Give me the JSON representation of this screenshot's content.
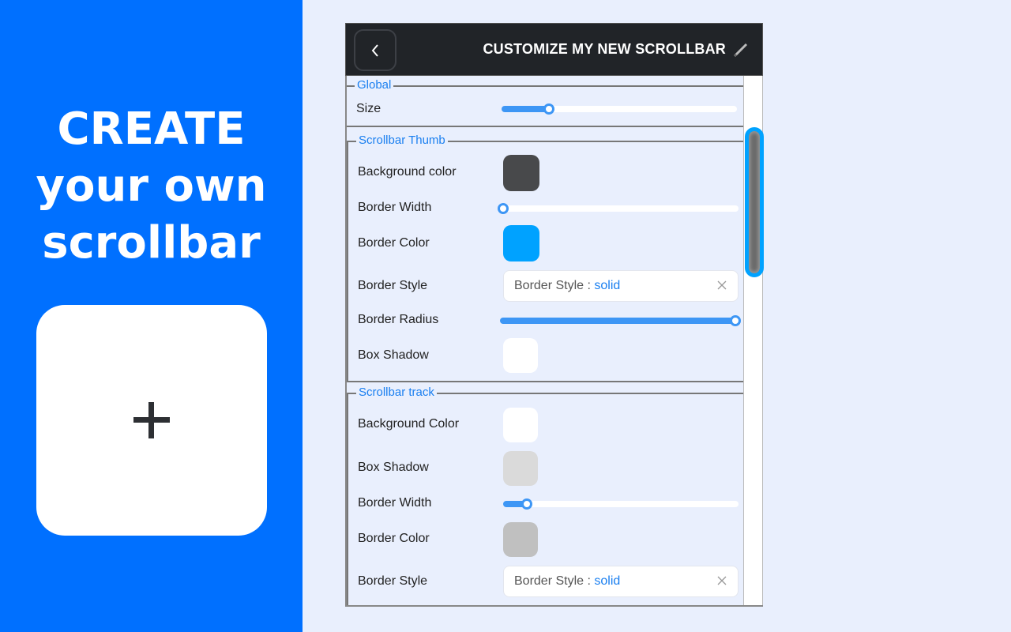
{
  "promo": {
    "headline_lines": [
      "CREATE",
      "your own",
      "scrollbar"
    ],
    "add_icon": "plus-icon"
  },
  "header": {
    "title": "CUSTOMIZE MY NEW SCROLLBAR",
    "back_icon": "chevron-left-icon",
    "edit_icon": "pencil-icon"
  },
  "sections": {
    "global": {
      "legend": "Global",
      "size_label": "Size",
      "size_value": 0.2
    },
    "thumb": {
      "legend": "Scrollbar Thumb",
      "bg_label": "Background color",
      "bg_color": "#48494b",
      "bw_label": "Border Width",
      "bw_value": 0.0,
      "bc_label": "Border Color",
      "bc_color": "#00a2ff",
      "bs_label": "Border Style",
      "bs_prefix": "Border Style",
      "bs_value": "solid",
      "br_label": "Border Radius",
      "br_value": 1.0,
      "shadow_label": "Box Shadow",
      "shadow_color": "#ffffff"
    },
    "track": {
      "legend": "Scrollbar track",
      "bg_label": "Background Color",
      "bg_color": "#ffffff",
      "shadow_label": "Box Shadow",
      "shadow_color": "#dadada",
      "bw_label": "Border Width",
      "bw_value": 0.1,
      "bc_label": "Border Color",
      "bc_color": "#c0c0c0",
      "bs_label": "Border Style",
      "bs_prefix": "Border Style",
      "bs_value": "solid"
    }
  },
  "colors": {
    "accent": "#0070ff",
    "link": "#1a7ff0",
    "scrollbar_thumb_border": "#00a2ff"
  }
}
